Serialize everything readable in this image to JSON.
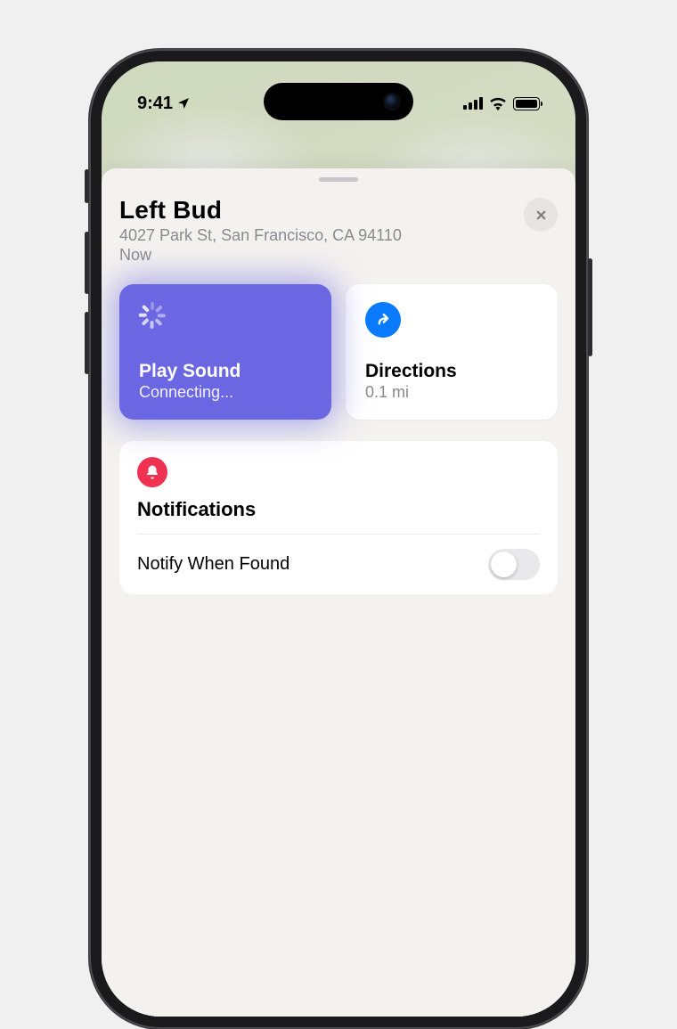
{
  "status": {
    "time": "9:41",
    "location_arrow": "➤"
  },
  "sheet": {
    "title": "Left Bud",
    "address": "4027 Park St, San Francisco, CA  94110",
    "timestamp": "Now"
  },
  "tiles": {
    "play_sound": {
      "title": "Play Sound",
      "status": "Connecting..."
    },
    "directions": {
      "title": "Directions",
      "distance": "0.1 mi"
    }
  },
  "notifications": {
    "heading": "Notifications",
    "rows": [
      {
        "label": "Notify When Found",
        "enabled": false
      }
    ]
  },
  "colors": {
    "accent_purple": "#6b66e2",
    "accent_blue": "#0a7aff",
    "accent_red": "#ef3152"
  }
}
